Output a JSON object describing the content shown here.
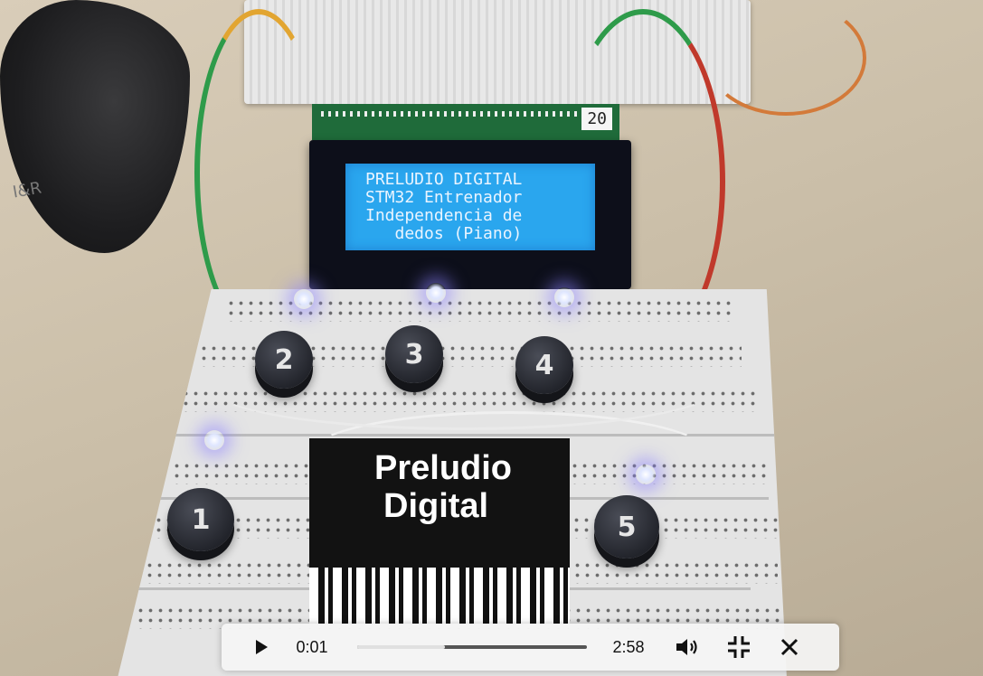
{
  "video": {
    "current_time": "0:01",
    "duration": "2:58",
    "progress_fraction": 0.38
  },
  "scene": {
    "mouse_brand": "I&R",
    "lcd_module_number": "20",
    "lcd_lines": [
      "PRELUDIO DIGITAL",
      "STM32 Entrenador",
      "Independencia de",
      "   dedos (Piano)"
    ],
    "logo_lines": [
      "Preludio",
      "Digital"
    ],
    "buttons": [
      "1",
      "2",
      "3",
      "4",
      "5"
    ]
  },
  "icons": {
    "play": "play-icon",
    "volume": "volume-icon",
    "exit_fullscreen": "exit-fullscreen-icon",
    "close": "close-icon"
  },
  "colors": {
    "lcd_backlight": "#2aa6ee",
    "led_glow": "#8c82ff",
    "control_bar": "#f5f5f5"
  }
}
